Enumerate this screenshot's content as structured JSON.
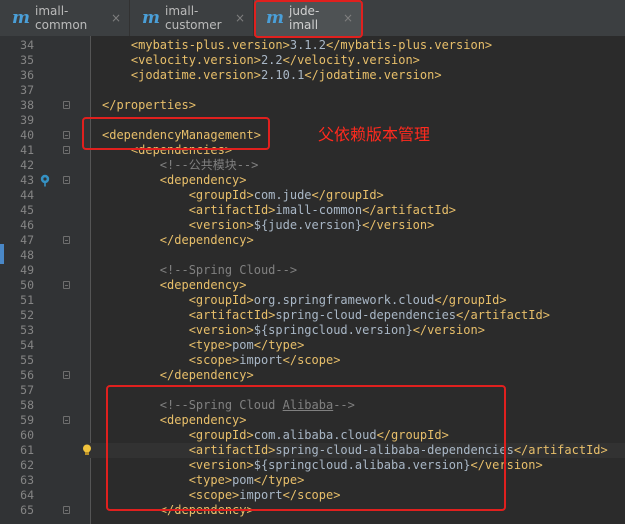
{
  "tabs": [
    {
      "label": "imall-common",
      "icon": "maven-m-icon",
      "active": false
    },
    {
      "label": "imall-customer",
      "icon": "maven-m-icon",
      "active": false
    },
    {
      "label": "jude-imall",
      "icon": "maven-m-icon",
      "active": true
    }
  ],
  "close_glyph": "×",
  "annotation": {
    "text": "父依赖版本管理",
    "color": "#e0201e"
  },
  "colors": {
    "tag": "#e8bf6a",
    "text": "#a9b7c6",
    "comment": "#808080",
    "background": "#2b2b2b",
    "gutter": "#313335"
  },
  "code_lines": [
    {
      "num": "34",
      "indent": "    ",
      "parts": [
        [
          "t",
          "<mybatis-plus.version>"
        ],
        [
          "x",
          "3.1.2"
        ],
        [
          "t",
          "</mybatis-plus.version>"
        ]
      ]
    },
    {
      "num": "35",
      "indent": "    ",
      "parts": [
        [
          "t",
          "<velocity.version>"
        ],
        [
          "x",
          "2.2"
        ],
        [
          "t",
          "</velocity.version>"
        ]
      ]
    },
    {
      "num": "36",
      "indent": "    ",
      "parts": [
        [
          "t",
          "<jodatime.version>"
        ],
        [
          "x",
          "2.10.1"
        ],
        [
          "t",
          "</jodatime.version>"
        ]
      ]
    },
    {
      "num": "37",
      "indent": "",
      "parts": []
    },
    {
      "num": "38",
      "indent": "",
      "parts": [
        [
          "t",
          "</properties>"
        ]
      ],
      "fold": true
    },
    {
      "num": "39",
      "indent": "",
      "parts": []
    },
    {
      "num": "40",
      "indent": "",
      "parts": [
        [
          "t",
          "<dependencyManagement>"
        ]
      ],
      "fold": true
    },
    {
      "num": "41",
      "indent": "    ",
      "parts": [
        [
          "t",
          "<dependencies>"
        ]
      ],
      "fold": true
    },
    {
      "num": "42",
      "indent": "        ",
      "parts": [
        [
          "c",
          "<!--公共模块-->"
        ]
      ]
    },
    {
      "num": "43",
      "indent": "        ",
      "parts": [
        [
          "t",
          "<dependency>"
        ]
      ],
      "fold": true,
      "gicon": true
    },
    {
      "num": "44",
      "indent": "            ",
      "parts": [
        [
          "t",
          "<groupId>"
        ],
        [
          "x",
          "com.jude"
        ],
        [
          "t",
          "</groupId>"
        ]
      ]
    },
    {
      "num": "45",
      "indent": "            ",
      "parts": [
        [
          "t",
          "<artifactId>"
        ],
        [
          "x",
          "imall-common"
        ],
        [
          "t",
          "</artifactId>"
        ]
      ]
    },
    {
      "num": "46",
      "indent": "            ",
      "parts": [
        [
          "t",
          "<version>"
        ],
        [
          "x",
          "${jude.version}"
        ],
        [
          "t",
          "</version>"
        ]
      ]
    },
    {
      "num": "47",
      "indent": "        ",
      "parts": [
        [
          "t",
          "</dependency>"
        ]
      ],
      "fold": true
    },
    {
      "num": "48",
      "indent": "",
      "parts": []
    },
    {
      "num": "49",
      "indent": "        ",
      "parts": [
        [
          "c",
          "<!--Spring Cloud-->"
        ]
      ]
    },
    {
      "num": "50",
      "indent": "        ",
      "parts": [
        [
          "t",
          "<dependency>"
        ]
      ],
      "fold": true
    },
    {
      "num": "51",
      "indent": "            ",
      "parts": [
        [
          "t",
          "<groupId>"
        ],
        [
          "x",
          "org.springframework.cloud"
        ],
        [
          "t",
          "</groupId>"
        ]
      ]
    },
    {
      "num": "52",
      "indent": "            ",
      "parts": [
        [
          "t",
          "<artifactId>"
        ],
        [
          "x",
          "spring-cloud-dependencies"
        ],
        [
          "t",
          "</artifactId>"
        ]
      ]
    },
    {
      "num": "53",
      "indent": "            ",
      "parts": [
        [
          "t",
          "<version>"
        ],
        [
          "x",
          "${springcloud.version}"
        ],
        [
          "t",
          "</version>"
        ]
      ]
    },
    {
      "num": "54",
      "indent": "            ",
      "parts": [
        [
          "t",
          "<type>"
        ],
        [
          "x",
          "pom"
        ],
        [
          "t",
          "</type>"
        ]
      ]
    },
    {
      "num": "55",
      "indent": "            ",
      "parts": [
        [
          "t",
          "<scope>"
        ],
        [
          "x",
          "import"
        ],
        [
          "t",
          "</scope>"
        ]
      ]
    },
    {
      "num": "56",
      "indent": "        ",
      "parts": [
        [
          "t",
          "</dependency>"
        ]
      ],
      "fold": true
    },
    {
      "num": "57",
      "indent": "",
      "parts": []
    },
    {
      "num": "58",
      "indent": "        ",
      "parts": [
        [
          "c",
          "<!--Spring Cloud "
        ],
        [
          "cu",
          "Alibaba"
        ],
        [
          "c",
          "-->"
        ]
      ]
    },
    {
      "num": "59",
      "indent": "        ",
      "parts": [
        [
          "t",
          "<dependency>"
        ]
      ],
      "fold": true
    },
    {
      "num": "60",
      "indent": "            ",
      "parts": [
        [
          "t",
          "<groupId>"
        ],
        [
          "x",
          "com.alibaba.cloud"
        ],
        [
          "t",
          "</groupId>"
        ]
      ]
    },
    {
      "num": "61",
      "indent": "            ",
      "parts": [
        [
          "t",
          "<artifactId>"
        ],
        [
          "x",
          "spring-cloud-alibaba-dependencies"
        ],
        [
          "t",
          "</artifactId>"
        ]
      ],
      "bulb": true,
      "hl": true
    },
    {
      "num": "62",
      "indent": "            ",
      "parts": [
        [
          "t",
          "<version>"
        ],
        [
          "x",
          "${springcloud.alibaba.version}"
        ],
        [
          "t",
          "</version>"
        ]
      ]
    },
    {
      "num": "63",
      "indent": "            ",
      "parts": [
        [
          "t",
          "<type>"
        ],
        [
          "x",
          "pom"
        ],
        [
          "t",
          "</type>"
        ]
      ]
    },
    {
      "num": "64",
      "indent": "            ",
      "parts": [
        [
          "t",
          "<scope>"
        ],
        [
          "x",
          "import"
        ],
        [
          "t",
          "</scope>"
        ]
      ]
    },
    {
      "num": "65",
      "indent": "        ",
      "parts": [
        [
          "t",
          "</dependency>"
        ]
      ],
      "fold": true
    }
  ]
}
